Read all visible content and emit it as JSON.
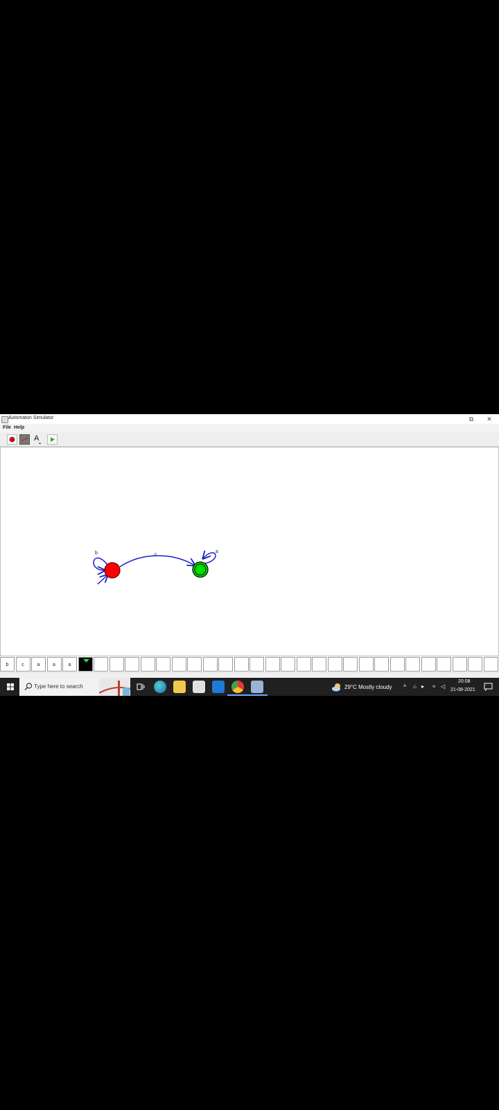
{
  "window": {
    "title": "Automaton Simulator",
    "restore_glyph": "⧉",
    "close_glyph": "✕"
  },
  "menu": [
    {
      "label": "File"
    },
    {
      "label": "Help"
    }
  ],
  "toolbar": {
    "tools": [
      "state-tool",
      "transition-tool",
      "text-tool",
      "run-button"
    ],
    "text_tool_label": "A"
  },
  "automaton": {
    "states": [
      {
        "id": "q0",
        "initial": true,
        "accepting": false,
        "color": "#ff0000"
      },
      {
        "id": "q1",
        "initial": false,
        "accepting": true,
        "color": "#00dd00"
      }
    ],
    "transitions": [
      {
        "from": "q0",
        "to": "q0",
        "label": "b"
      },
      {
        "from": "q0",
        "to": "q1",
        "label": "c"
      },
      {
        "from": "q1",
        "to": "q1",
        "label": "a"
      }
    ],
    "edge_color": "#1c1cc8"
  },
  "tape": {
    "cells": [
      "b",
      "c",
      "a",
      "a",
      "a",
      "",
      "",
      "",
      "",
      "",
      "",
      "",
      "",
      "",
      "",
      "",
      "",
      "",
      "",
      "",
      "",
      "",
      "",
      "",
      "",
      "",
      "",
      "",
      "",
      "",
      "",
      "",
      ""
    ],
    "head_index": 5,
    "head_marker_color": "#33dd33"
  },
  "taskbar": {
    "search_placeholder": "Type here to search",
    "weather": "29°C  Mostly cloudy",
    "time": "20:08",
    "date": "21-08-2021"
  }
}
